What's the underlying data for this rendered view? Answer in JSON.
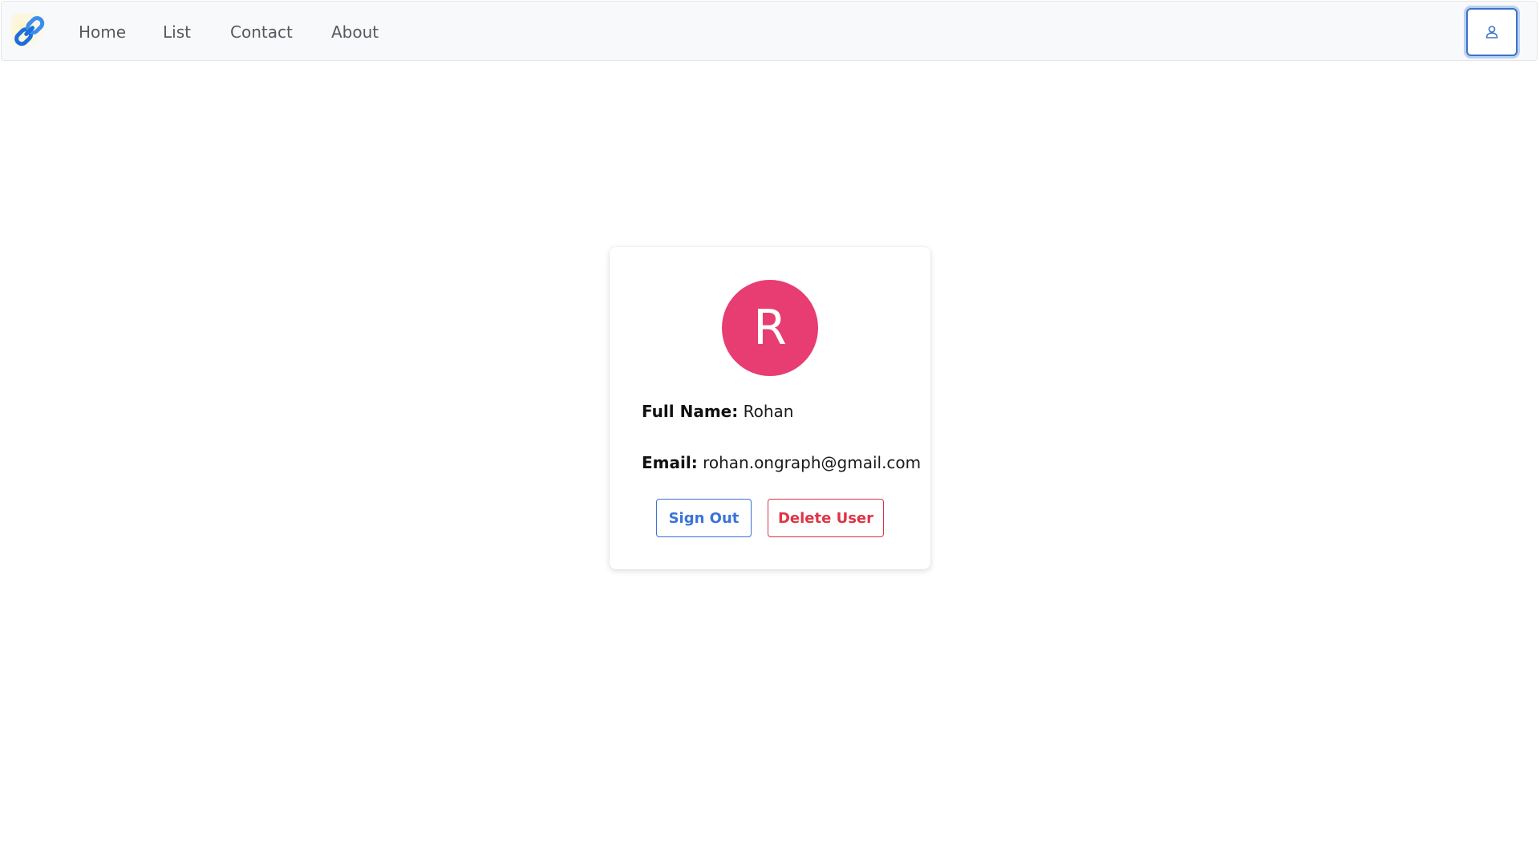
{
  "navbar": {
    "brand_icon": "chain-link-icon",
    "links": [
      {
        "label": "Home"
      },
      {
        "label": "List"
      },
      {
        "label": "Contact"
      },
      {
        "label": "About"
      }
    ],
    "profile_icon": "user-icon",
    "accent_color": "#3b73c8"
  },
  "profile": {
    "avatar_initial": "R",
    "avatar_color": "#e73d73",
    "full_name_label": "Full Name:",
    "full_name_value": "Rohan",
    "email_label": "Email:",
    "email_value": "rohan.ongraph@gmail.com",
    "sign_out_label": "Sign Out",
    "delete_label": "Delete User",
    "sign_out_color": "#3b73d9",
    "delete_color": "#dc3545"
  }
}
